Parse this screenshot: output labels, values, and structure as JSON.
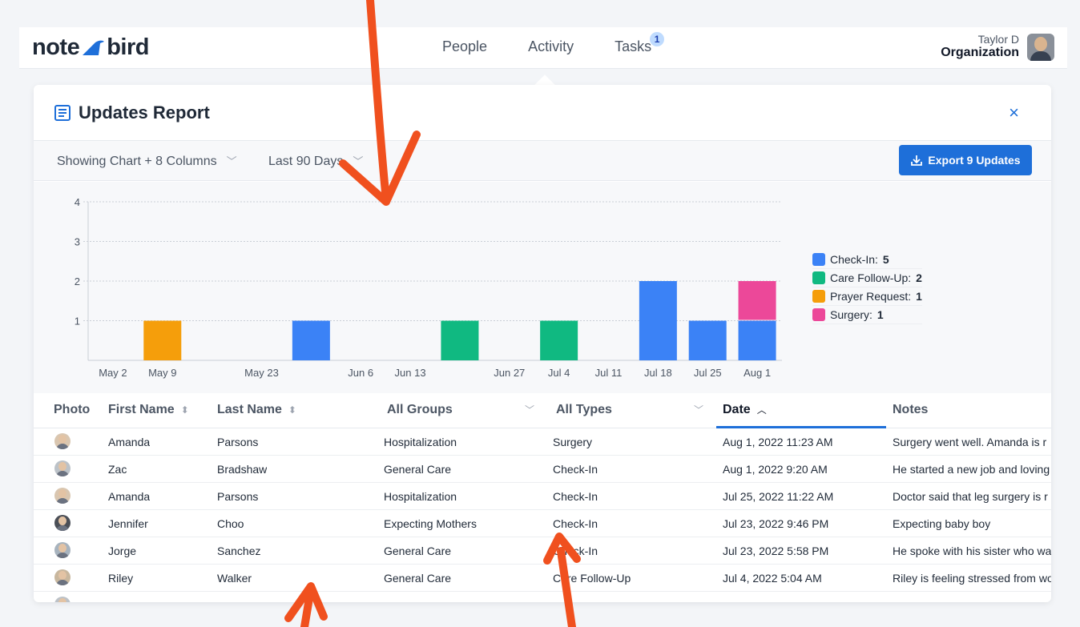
{
  "app": {
    "logo_left": "note",
    "logo_right": "bird",
    "nav": [
      {
        "label": "People"
      },
      {
        "label": "Activity"
      },
      {
        "label": "Tasks",
        "badge": "1"
      }
    ],
    "user_name": "Taylor D",
    "org_name": "Organization"
  },
  "report": {
    "title": "Updates Report",
    "close_icon": "×",
    "filter_columns": "Showing Chart + 8 Columns",
    "filter_range": "Last 90 Days",
    "export_label": "Export 9 Updates"
  },
  "chart_data": {
    "type": "bar",
    "stacked": true,
    "ylim": [
      0,
      4
    ],
    "yticks": [
      1,
      2,
      3,
      4
    ],
    "grid": true,
    "legend_position": "right",
    "x_ticks": [
      "May 2",
      "May 9",
      "May 23",
      "Jun 6",
      "Jun 13",
      "Jun 27",
      "Jul 4",
      "Jul 11",
      "Jul 18",
      "Jul 25",
      "Aug 1"
    ],
    "bars": [
      {
        "week": "May 9",
        "series": "Prayer Request",
        "value": 1
      },
      {
        "week": "May 30",
        "series": "Check-In",
        "value": 1
      },
      {
        "week": "Jun 20",
        "series": "Care Follow-Up",
        "value": 1
      },
      {
        "week": "Jul 4",
        "series": "Care Follow-Up",
        "value": 1
      },
      {
        "week": "Jul 18",
        "series": "Check-In",
        "value": 2
      },
      {
        "week": "Jul 25",
        "series": "Check-In",
        "value": 1
      },
      {
        "week": "Aug 1",
        "series": "Check-In",
        "value": 1
      },
      {
        "week": "Aug 1",
        "series": "Surgery",
        "value": 1
      }
    ],
    "legend": [
      {
        "name": "Check-In",
        "count": "5",
        "color": "#3b82f6"
      },
      {
        "name": "Care Follow-Up",
        "count": "2",
        "color": "#10b981"
      },
      {
        "name": "Prayer Request",
        "count": "1",
        "color": "#f59e0b"
      },
      {
        "name": "Surgery",
        "count": "1",
        "color": "#ec4899"
      }
    ]
  },
  "table": {
    "headers": [
      "Photo",
      "First Name",
      "Last Name",
      "All Groups",
      "All Types",
      "Date",
      "Notes"
    ],
    "rows": [
      {
        "first": "Amanda",
        "last": "Parsons",
        "group": "Hospitalization",
        "type": "Surgery",
        "date": "Aug 1, 2022 11:23 AM",
        "notes": "Surgery went well. Amanda is r"
      },
      {
        "first": "Zac",
        "last": "Bradshaw",
        "group": "General Care",
        "type": "Check-In",
        "date": "Aug 1, 2022 9:20 AM",
        "notes": "He started a new job and loving"
      },
      {
        "first": "Amanda",
        "last": "Parsons",
        "group": "Hospitalization",
        "type": "Check-In",
        "date": "Jul 25, 2022 11:22 AM",
        "notes": "Doctor said that leg surgery is r"
      },
      {
        "first": "Jennifer",
        "last": "Choo",
        "group": "Expecting Mothers",
        "type": "Check-In",
        "date": "Jul 23, 2022 9:46 PM",
        "notes": "Expecting baby boy"
      },
      {
        "first": "Jorge",
        "last": "Sanchez",
        "group": "General Care",
        "type": "Check-In",
        "date": "Jul 23, 2022 5:58 PM",
        "notes": "He spoke with his sister who wa"
      },
      {
        "first": "Riley",
        "last": "Walker",
        "group": "General Care",
        "type": "Care Follow-Up",
        "date": "Jul 4, 2022 5:04 AM",
        "notes": "Riley is feeling stressed from wo"
      }
    ]
  },
  "colors": {
    "accent": "#1e6fd9",
    "annotation_arrow": "#f0501e"
  },
  "icons": [
    "report-icon",
    "close-icon",
    "chevron-down-icon",
    "download-icon",
    "sort-icon",
    "sort-up-icon"
  ]
}
